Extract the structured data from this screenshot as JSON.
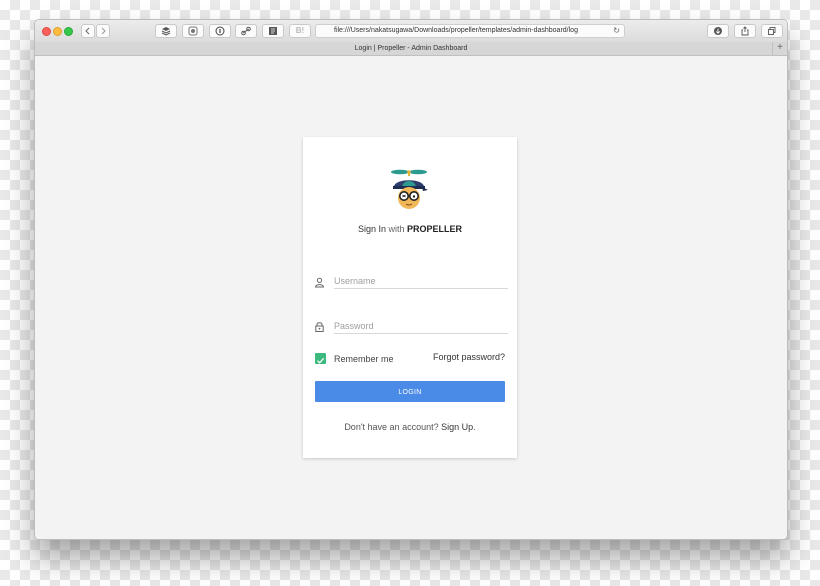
{
  "browser": {
    "url": "file:///Users/nakatsugawa/Downloads/propeller/templates/admin-dashboard/log",
    "tab_title": "Login | Propeller - Admin Dashboard",
    "toolbar_b_label": "B!",
    "tab_add_label": "+"
  },
  "login": {
    "title_prefix": "Sign In",
    "title_with": "with",
    "brand": "PROPELLER",
    "username_placeholder": "Username",
    "password_placeholder": "Password",
    "remember_label": "Remember me",
    "remember_checked": true,
    "forgot_label": "Forgot password?",
    "login_button": "LOGIN",
    "signup_prompt": "Don't have an account?",
    "signup_link": "Sign Up",
    "signup_suffix": ".",
    "accent_color": "#4a8be8",
    "check_color": "#3bb97e"
  }
}
